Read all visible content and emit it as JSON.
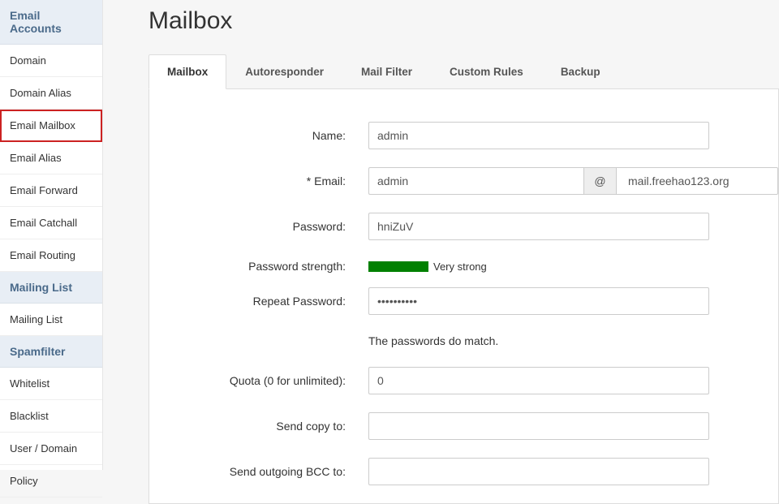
{
  "sidebar": {
    "groups": [
      {
        "title": "Email Accounts",
        "items": [
          {
            "label": "Domain",
            "highlighted": false
          },
          {
            "label": "Domain Alias",
            "highlighted": false
          },
          {
            "label": "Email Mailbox",
            "highlighted": true
          },
          {
            "label": "Email Alias",
            "highlighted": false
          },
          {
            "label": "Email Forward",
            "highlighted": false
          },
          {
            "label": "Email Catchall",
            "highlighted": false
          },
          {
            "label": "Email Routing",
            "highlighted": false
          }
        ]
      },
      {
        "title": "Mailing List",
        "items": [
          {
            "label": "Mailing List",
            "highlighted": false
          }
        ]
      },
      {
        "title": "Spamfilter",
        "items": [
          {
            "label": "Whitelist",
            "highlighted": false
          },
          {
            "label": "Blacklist",
            "highlighted": false
          },
          {
            "label": "User / Domain",
            "highlighted": false
          },
          {
            "label": "Policy",
            "highlighted": false
          }
        ]
      }
    ]
  },
  "main": {
    "title": "Mailbox",
    "tabs": [
      {
        "label": "Mailbox",
        "active": true
      },
      {
        "label": "Autoresponder",
        "active": false
      },
      {
        "label": "Mail Filter",
        "active": false
      },
      {
        "label": "Custom Rules",
        "active": false
      },
      {
        "label": "Backup",
        "active": false
      }
    ],
    "form": {
      "name_label": "Name:",
      "name_value": "admin",
      "email_label": "* Email:",
      "email_local": "admin",
      "email_at": "@",
      "email_domain": "mail.freehao123.org",
      "password_label": "Password:",
      "password_value": "hniZuV",
      "strength_label": "Password strength:",
      "strength_text": "Very strong",
      "strength_color": "#008000",
      "repeat_label": "Repeat Password:",
      "repeat_value": "••••••••••",
      "match_text": "The passwords do match.",
      "quota_label": "Quota (0 for unlimited):",
      "quota_value": "0",
      "sendcopy_label": "Send copy to:",
      "sendcopy_value": "",
      "bcc_label": "Send outgoing BCC to:",
      "bcc_value": ""
    }
  }
}
